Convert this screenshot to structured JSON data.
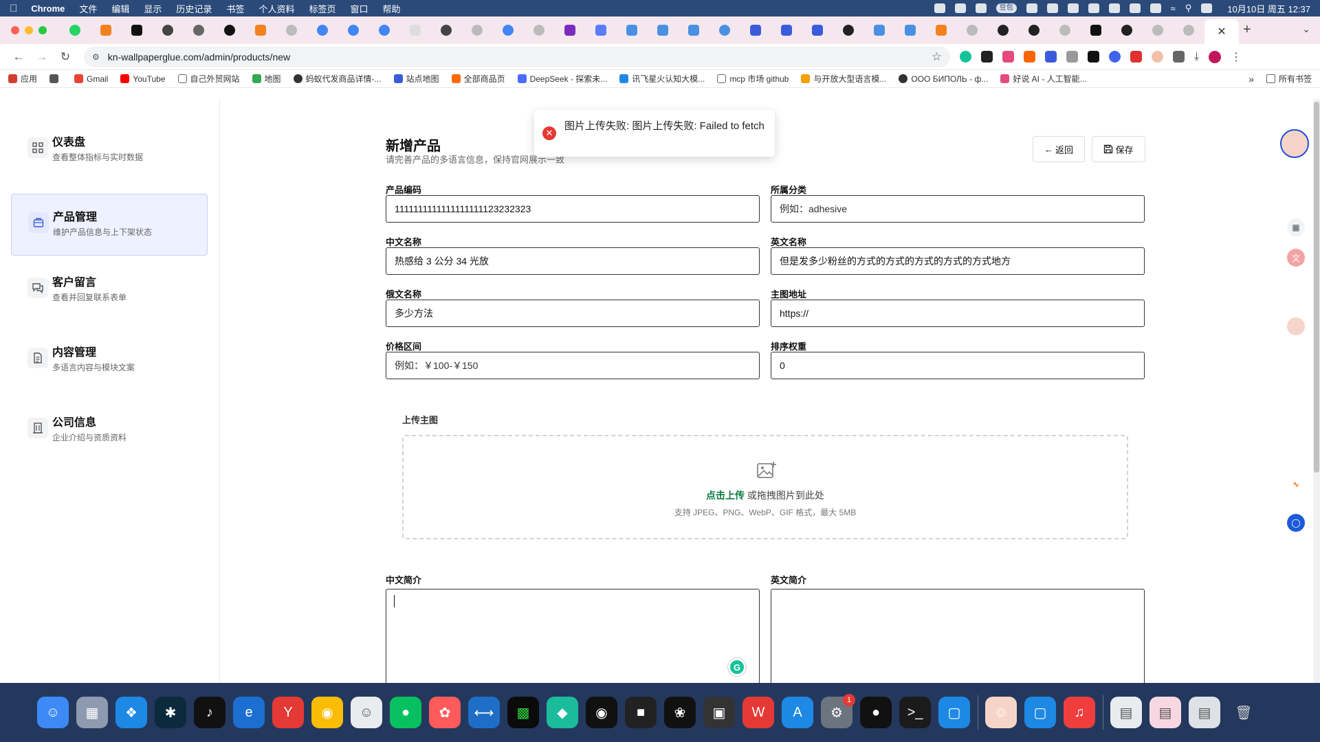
{
  "menubar": {
    "app": "Chrome",
    "items": [
      "文件",
      "编辑",
      "显示",
      "历史记录",
      "书签",
      "个人资料",
      "标签页",
      "窗口",
      "帮助"
    ],
    "tray_badge": "豆包",
    "clock": "10月10日 周五 12:37"
  },
  "browser": {
    "url": "kn-wallpaperglue.com/admin/products/new",
    "bookmarks": [
      {
        "label": "应用",
        "icon": "apps-grid-icon",
        "color": "#d23f31"
      },
      {
        "label": "",
        "icon": "tab-groups-icon",
        "color": "#555555"
      },
      {
        "label": "Gmail",
        "icon": "gmail-icon",
        "color": "#ea4335"
      },
      {
        "label": "YouTube",
        "icon": "youtube-icon",
        "color": "#ff0000"
      },
      {
        "label": "自己外贸网站",
        "icon": "folder-icon",
        "color": "#666666"
      },
      {
        "label": "地图",
        "icon": "maps-icon",
        "color": "#34a853"
      },
      {
        "label": "蚂蚁代发商品详情-...",
        "icon": "globe-icon",
        "color": "#333333"
      },
      {
        "label": "站点地图",
        "icon": "site-icon",
        "color": "#3b5bdb"
      },
      {
        "label": "全部商品页",
        "icon": "shop-icon",
        "color": "#ff6a00"
      },
      {
        "label": "DeepSeek - 探索未...",
        "icon": "deepseek-icon",
        "color": "#4d6bfe"
      },
      {
        "label": "讯飞星火认知大模...",
        "icon": "spark-icon",
        "color": "#1e88e5"
      },
      {
        "label": "mcp 市场 github",
        "icon": "folder-icon",
        "color": "#666666"
      },
      {
        "label": "与开放大型语言模...",
        "icon": "llm-icon",
        "color": "#f59f00"
      },
      {
        "label": "ООО БИПОЛЬ - ф...",
        "icon": "globe-icon",
        "color": "#333333"
      },
      {
        "label": "好说 AI - 人工智能...",
        "icon": "haoshuo-icon",
        "color": "#e64980"
      }
    ],
    "bookmarks_all": "所有书签",
    "bookmarks_more": "»"
  },
  "sidebar": {
    "items": [
      {
        "title": "仪表盘",
        "sub": "查看整体指标与实时数据",
        "icon": "dashboard-icon"
      },
      {
        "title": "产品管理",
        "sub": "维护产品信息与上下架状态",
        "icon": "package-icon"
      },
      {
        "title": "客户留言",
        "sub": "查看并回复联系表单",
        "icon": "messages-icon"
      },
      {
        "title": "内容管理",
        "sub": "多语言内容与模块文案",
        "icon": "document-icon"
      },
      {
        "title": "公司信息",
        "sub": "企业介绍与资质资料",
        "icon": "building-icon"
      }
    ]
  },
  "header": {
    "title": "新增产品",
    "desc": "请完善产品的多语言信息，保持官网展示一致",
    "back": "返回",
    "save": "保存"
  },
  "form": {
    "code": {
      "label": "产品编码",
      "value": "1111111111111111111123232323",
      "placeholder": ""
    },
    "category": {
      "label": "所属分类",
      "value": "",
      "placeholder": "例如：adhesive"
    },
    "name_zh": {
      "label": "中文名称",
      "value": "热感给 3 公分 34 光放",
      "placeholder": ""
    },
    "name_en": {
      "label": "英文名称",
      "value": "但是发多少粉丝的方式的方式的方式的方式的方式地方",
      "placeholder": ""
    },
    "name_ru": {
      "label": "俄文名称",
      "value": "多少方法",
      "placeholder": ""
    },
    "main_image": {
      "label": "主图地址",
      "value": "https://",
      "placeholder": ""
    },
    "price": {
      "label": "价格区间",
      "value": "",
      "placeholder": "例如：￥100-￥150"
    },
    "sort": {
      "label": "排序权重",
      "value": "0",
      "placeholder": ""
    }
  },
  "upload": {
    "label": "上传主图",
    "link": "点击上传",
    "text": " 或拖拽图片到此处",
    "hint": "支持 JPEG、PNG、WebP、GIF 格式，最大 5MB"
  },
  "intro": {
    "zh_label": "中文简介",
    "en_label": "英文简介"
  },
  "toast": {
    "message": "图片上传失败: 图片上传失败: Failed to fetch",
    "icon": "error-icon"
  },
  "dock": {
    "badge_count": "1"
  },
  "colors": {
    "accent": "#3b5bdb",
    "active_nav_bg": "#eef1ff",
    "error": "#e53935",
    "upload_link": "#0a7a3c"
  }
}
